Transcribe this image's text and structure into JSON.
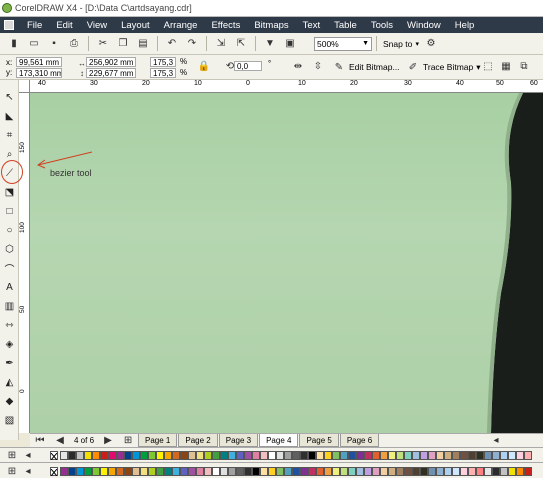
{
  "window": {
    "title": "CorelDRAW X4 - [D:\\Data C\\artdsayang.cdr]"
  },
  "menubar": {
    "items": [
      "File",
      "Edit",
      "View",
      "Layout",
      "Arrange",
      "Effects",
      "Bitmaps",
      "Text",
      "Table",
      "Tools",
      "Window",
      "Help"
    ]
  },
  "toolbar1": {
    "zoom": "500%",
    "snap": "Snap to"
  },
  "propertybar": {
    "x_label": "x:",
    "x_value": "99,561 mm",
    "y_label": "y:",
    "y_value": "173,310 mm",
    "w_value": "256,902 mm",
    "h_value": "229,677 mm",
    "scale_w": "175,3",
    "scale_h": "175,3",
    "pct": "%",
    "rotate": "0,0",
    "deg": "°",
    "edit_bitmap": "Edit Bitmap...",
    "trace_bitmap": "Trace Bitmap"
  },
  "ruler_h": {
    "labels": [
      "40",
      "30",
      "20",
      "10",
      "0",
      "10",
      "20",
      "30",
      "40",
      "50",
      "60"
    ]
  },
  "ruler_v": {
    "labels": [
      "150",
      "100",
      "50",
      "0"
    ]
  },
  "annotation": {
    "label": "bezier tool"
  },
  "pager": {
    "counter": "4 of 6",
    "tabs": [
      "Page 1",
      "Page 2",
      "Page 3",
      "Page 4",
      "Page 5",
      "Page 6"
    ],
    "active_tab": "Page 4"
  },
  "colors": {
    "palette": [
      "#e6e6e6",
      "#2b2b2b",
      "#c2c2c2",
      "#f2e100",
      "#ff8c00",
      "#c82018",
      "#e20a6e",
      "#963090",
      "#00428c",
      "#0096d6",
      "#009e3c",
      "#7ec832",
      "#fff200",
      "#f7a600",
      "#d2691e",
      "#8b4513",
      "#e0c090",
      "#f0e080",
      "#b0d020",
      "#40a040",
      "#008080",
      "#40b0e0",
      "#6060c0",
      "#a050a0",
      "#e080a0",
      "#f0c0c0",
      "#ffffff",
      "#e0e0e0",
      "#a0a0a0",
      "#606060",
      "#303030",
      "#000000",
      "#ffe0a0",
      "#ffd020",
      "#80c060",
      "#50a0c0",
      "#2050a0",
      "#803090",
      "#c03060",
      "#e06030",
      "#f0a040",
      "#f0f080",
      "#c0e080",
      "#80d0c0",
      "#a0c0e0",
      "#c0a0e0",
      "#e0a0c0",
      "#f0d0a0",
      "#d0b080",
      "#a08060",
      "#705040",
      "#504030",
      "#303020",
      "#7090b0",
      "#90b0d0",
      "#b0d0f0",
      "#d0e8ff",
      "#ffd0e0",
      "#ffb0b0",
      "#ff8080"
    ]
  }
}
